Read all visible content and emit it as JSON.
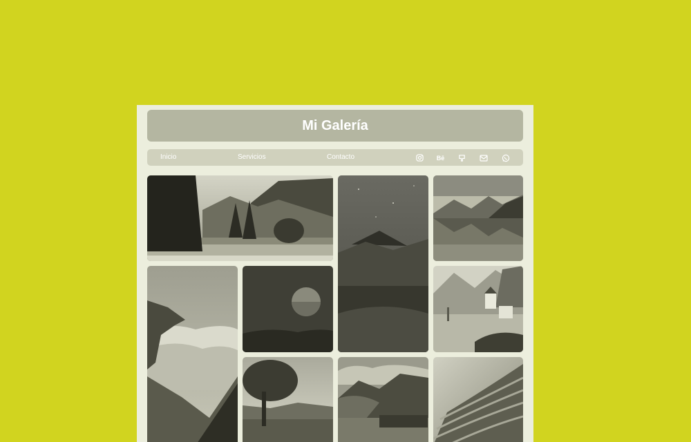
{
  "header": {
    "title": "Mi Galería"
  },
  "nav": {
    "links": [
      "Inicio",
      "Servicios",
      "Contacto"
    ],
    "icons": [
      "instagram-icon",
      "behance-icon",
      "github-icon",
      "mail-icon",
      "whatsapp-icon"
    ],
    "behance_text": "Bē"
  },
  "colors": {
    "page_background": "#d1d41f",
    "card_background": "#eceedd",
    "header_background": "#b4b6a1",
    "nav_background": "#d0d1bd"
  },
  "gallery": {
    "images": [
      "forest-meadow",
      "starry-mountain-valley",
      "mountain-lake",
      "cliff-above-clouds",
      "moon-over-hills",
      "alpine-village",
      "tree-countryside",
      "mountain-river",
      "rice-terraces"
    ]
  }
}
